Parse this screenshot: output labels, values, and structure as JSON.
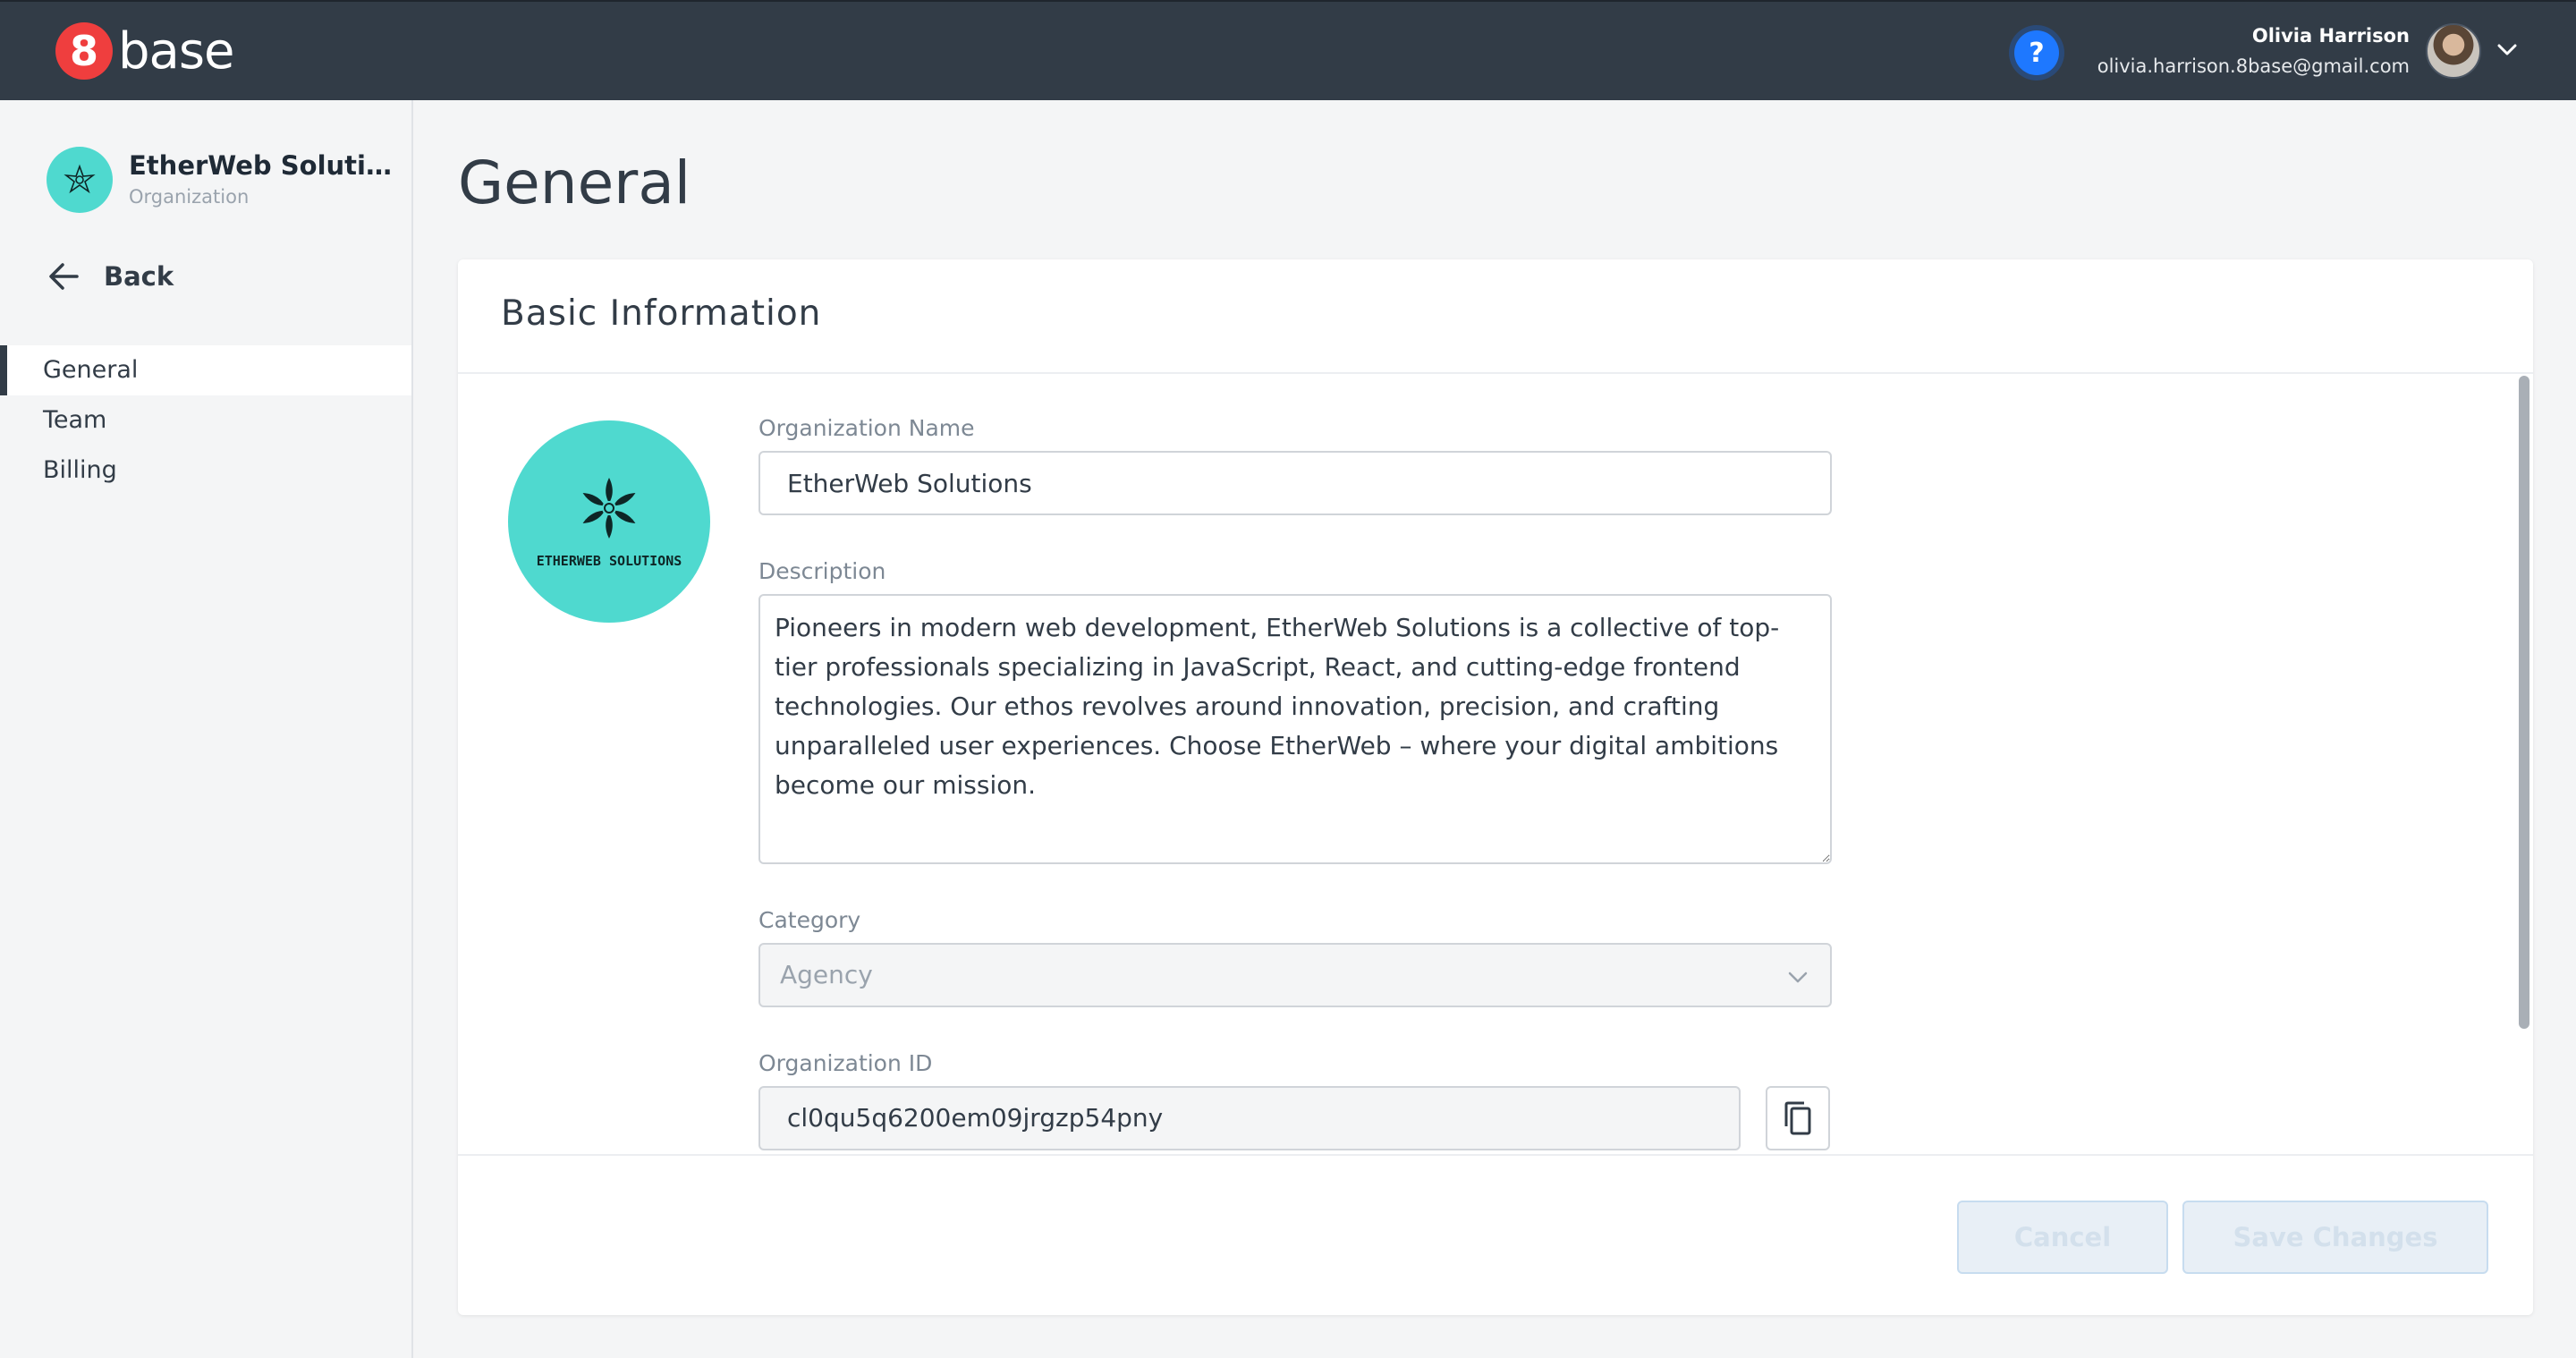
{
  "topbar": {
    "logo_badge": "8",
    "logo_text": "base",
    "help_label": "?",
    "user_name": "Olivia Harrison",
    "user_email": "olivia.harrison.8base@gmail.com"
  },
  "sidebar": {
    "org_name": "EtherWeb Soluti…",
    "org_subtitle": "Organization",
    "back_label": "Back",
    "nav": [
      {
        "label": "General",
        "active": true
      },
      {
        "label": "Team",
        "active": false
      },
      {
        "label": "Billing",
        "active": false
      }
    ]
  },
  "main": {
    "page_title": "General",
    "card_title": "Basic Information",
    "logo_text": "ETHERWEB SOLUTIONS",
    "fields": {
      "org_name_label": "Organization Name",
      "org_name_value": "EtherWeb Solutions",
      "description_label": "Description",
      "description_value": "Pioneers in modern web development, EtherWeb Solutions is a collective of top-tier professionals specializing in JavaScript, React, and cutting-edge frontend technologies. Our ethos revolves around innovation, precision, and crafting unparalleled user experiences. Choose EtherWeb – where your digital ambitions become our mission.",
      "category_label": "Category",
      "category_value": "Agency",
      "org_id_label": "Organization ID",
      "org_id_value": "cl0qu5q6200em09jrgzp54pny"
    },
    "buttons": {
      "cancel": "Cancel",
      "save": "Save Changes"
    }
  },
  "colors": {
    "topbar_bg": "#323c47",
    "logo_red": "#ef3e3e",
    "help_blue": "#1e78ff",
    "org_teal": "#4fd9cf",
    "disabled_button_text": "#d3e0ec"
  },
  "icons": [
    "help-icon",
    "chevron-down-icon",
    "arrow-left-icon",
    "star-emblem-icon",
    "copy-icon"
  ]
}
